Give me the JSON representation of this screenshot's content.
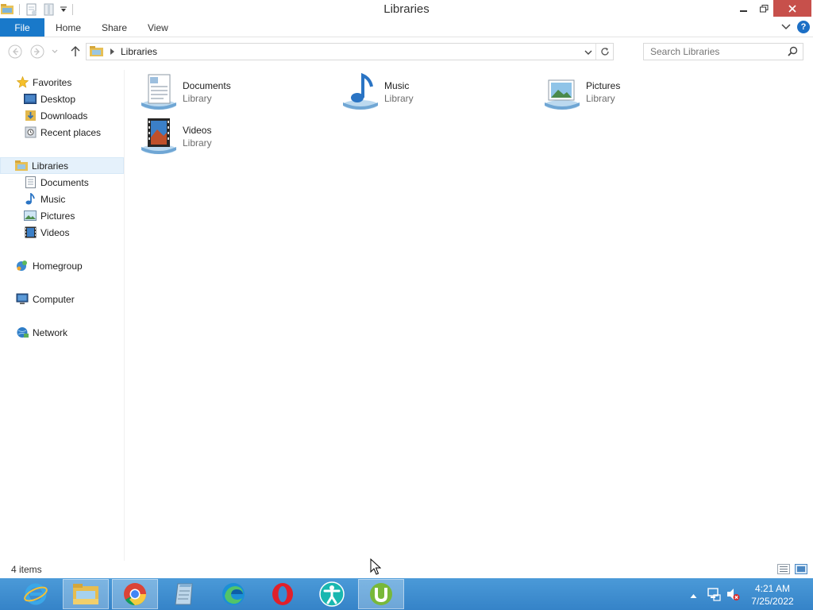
{
  "window": {
    "title": "Libraries"
  },
  "ribbon": {
    "tabs": [
      "File",
      "Home",
      "Share",
      "View"
    ]
  },
  "address": {
    "crumb": "Libraries",
    "search_placeholder": "Search Libraries"
  },
  "nav": {
    "favorites": {
      "label": "Favorites",
      "items": [
        "Desktop",
        "Downloads",
        "Recent places"
      ]
    },
    "libraries": {
      "label": "Libraries",
      "items": [
        "Documents",
        "Music",
        "Pictures",
        "Videos"
      ]
    },
    "homegroup": "Homegroup",
    "computer": "Computer",
    "network": "Network"
  },
  "content": {
    "libraries": [
      {
        "name": "Documents",
        "type": "Library",
        "icon": "documents-library-icon"
      },
      {
        "name": "Music",
        "type": "Library",
        "icon": "music-library-icon"
      },
      {
        "name": "Pictures",
        "type": "Library",
        "icon": "pictures-library-icon"
      },
      {
        "name": "Videos",
        "type": "Library",
        "icon": "videos-library-icon"
      }
    ]
  },
  "status": {
    "item_count": "4 items"
  },
  "taskbar": {
    "apps": [
      "internet-explorer-icon",
      "file-explorer-icon",
      "chrome-icon",
      "notepad-icon",
      "edge-icon",
      "opera-icon",
      "accessibility-app-icon",
      "utorrent-icon"
    ],
    "time": "4:21 AM",
    "date": "7/25/2022"
  },
  "colors": {
    "file_tab": "#1979ca",
    "close_button": "#c7504b",
    "taskbar": "#3a8bd1",
    "selection": "#e5f1fb"
  }
}
